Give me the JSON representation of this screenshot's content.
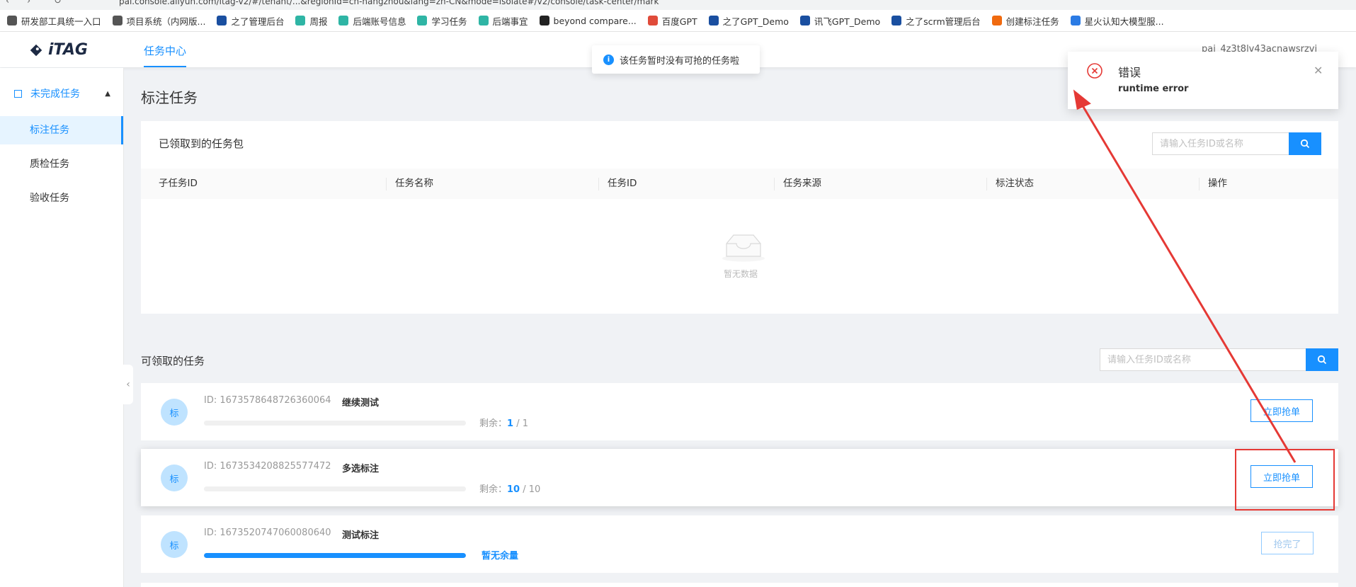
{
  "browser": {
    "url": "pai.console.aliyun.com/itag-v2/#/tenant/...&regionId=cn-hangzhou&lang=zh-CN&mode=isolate#/v2/console/task-center/mark",
    "bookmarks": [
      {
        "label": "研发部工具统一入口",
        "icon": "globe-icon",
        "color": "#555555"
      },
      {
        "label": "项目系统（内网版...",
        "icon": "globe-icon",
        "color": "#555555"
      },
      {
        "label": "之了管理后台",
        "icon": "z-icon",
        "color": "#1a4fa0"
      },
      {
        "label": "周报",
        "icon": "leaf-icon",
        "color": "#2fb5a5"
      },
      {
        "label": "后端账号信息",
        "icon": "leaf-icon",
        "color": "#2fb5a5"
      },
      {
        "label": "学习任务",
        "icon": "leaf-icon",
        "color": "#2fb5a5"
      },
      {
        "label": "后端事宜",
        "icon": "leaf-icon",
        "color": "#2fb5a5"
      },
      {
        "label": "beyond compare...",
        "icon": "beyond-compare-icon",
        "color": "#222222"
      },
      {
        "label": "百度GPT",
        "icon": "baidu-icon",
        "color": "#e04b3a"
      },
      {
        "label": "之了GPT_Demo",
        "icon": "z-icon",
        "color": "#1a4fa0"
      },
      {
        "label": "讯飞GPT_Demo",
        "icon": "z-icon",
        "color": "#1a4fa0"
      },
      {
        "label": "之了scrm管理后台",
        "icon": "z-icon",
        "color": "#1a4fa0"
      },
      {
        "label": "创建标注任务",
        "icon": "bracket-icon",
        "color": "#f06a0f"
      },
      {
        "label": "星火认知大模型服...",
        "icon": "spark-icon",
        "color": "#2b7be4"
      }
    ]
  },
  "header": {
    "logo_text": "iTAG",
    "tab": "任务中心",
    "user": "pai_4z3t8lv43acnawsrzvi"
  },
  "sidebar": {
    "group_label": "未完成任务",
    "items": [
      {
        "label": "标注任务",
        "active": true
      },
      {
        "label": "质检任务",
        "active": false
      },
      {
        "label": "验收任务",
        "active": false
      }
    ]
  },
  "main": {
    "page_title": "标注任务",
    "claimed": {
      "title": "已领取到的任务包",
      "search_placeholder": "请输入任务ID或名称",
      "columns": [
        "子任务ID",
        "任务名称",
        "任务ID",
        "任务来源",
        "标注状态",
        "操作"
      ],
      "empty_text": "暂无数据"
    },
    "available": {
      "title": "可领取的任务",
      "search_placeholder": "请输入任务ID或名称",
      "remain_label": "剩余：",
      "tasks": [
        {
          "avatar": "标",
          "id_label": "ID:",
          "id": "1673578648726360064",
          "name": "继续测试",
          "remaining": "1",
          "total": "/ 1",
          "progress": 0,
          "sold_out": false,
          "button": "立即抢单"
        },
        {
          "avatar": "标",
          "id_label": "ID:",
          "id": "1673534208825577472",
          "name": "多选标注",
          "remaining": "10",
          "total": "/ 10",
          "progress": 0,
          "sold_out": false,
          "button": "立即抢单"
        },
        {
          "avatar": "标",
          "id_label": "ID:",
          "id": "1673520747060080640",
          "name": "测试标注",
          "progress": 1.0,
          "sold_out": true,
          "sold_out_text": "暂无余量",
          "button": "抢完了"
        }
      ]
    }
  },
  "toast": {
    "text": "该任务暂时没有可抢的任务啦"
  },
  "notification": {
    "title": "错误",
    "message": "runtime error"
  },
  "colors": {
    "primary": "#1890ff",
    "error": "#e53935",
    "annotation": "#e53935"
  }
}
